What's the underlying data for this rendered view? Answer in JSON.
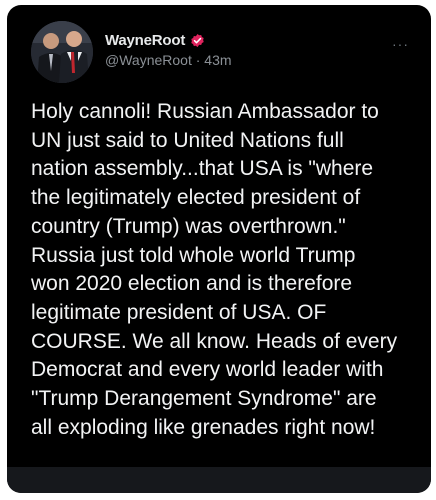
{
  "tweet": {
    "author": {
      "display_name": "WayneRoot",
      "handle": "@WayneRoot",
      "time_separator": "·",
      "timestamp": "43m",
      "badge_icon": "verified-badge-icon",
      "badge_color": "#e0245e"
    },
    "more_label": "···",
    "text_lines": [
      "Holy cannoli! Russian Ambassador to",
      "UN just said to United Nations full",
      "nation assembly...that USA is \"where",
      "the legitimately elected president of",
      "country (Trump) was overthrown.\"",
      "Russia just told whole world Trump",
      "won 2020 election and is therefore",
      "legitimate president of USA. OF",
      "COURSE. We all know. Heads of every",
      "Democrat and every world leader with",
      "\"Trump Derangement Syndrome\" are",
      "all exploding like grenades right now!"
    ]
  }
}
